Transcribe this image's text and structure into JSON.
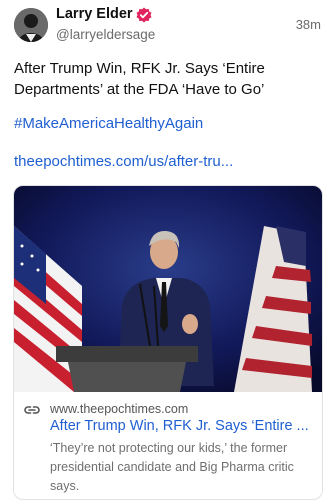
{
  "author": {
    "name": "Larry Elder",
    "handle": "@larryeldersage",
    "timestamp": "38m",
    "avatar_icon": "profile-photo",
    "verified_icon": "verified-badge-icon",
    "verified_color": "#e0245e"
  },
  "post": {
    "text": "After Trump Win, RFK Jr. Says ‘Entire Departments’ at the FDA ‘Have to Go’",
    "hashtag": "#MakeAmericaHealthyAgain",
    "link": "theepochtimes.com/us/after-tru...",
    "link_color": "#1f5fd1"
  },
  "card": {
    "image_description_icon": "speaker-podium-photo",
    "domain_icon": "link-icon",
    "domain": "www.theepochtimes.com",
    "title": "After Trump Win, RFK Jr. Says ‘Entire ...",
    "description": "‘They’re not protecting our kids,’ the former presidential candidate and Big Pharma critic says."
  }
}
